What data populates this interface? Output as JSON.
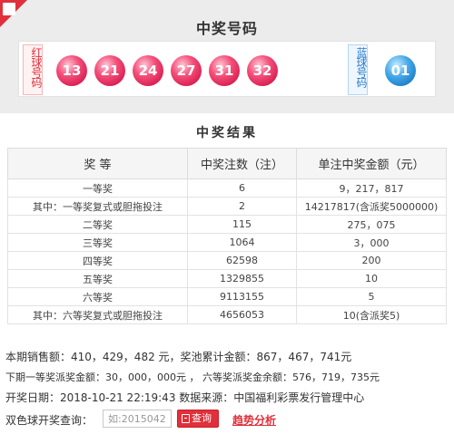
{
  "draw": {
    "title": "中奖号码",
    "red_label": "红球号码",
    "blue_label": "蓝球号码",
    "red_balls": [
      "13",
      "21",
      "24",
      "27",
      "31",
      "32"
    ],
    "blue_ball": "01",
    "colors": {
      "red": "#d81e50",
      "blue": "#1d7dc7",
      "accent": "#e0303b"
    }
  },
  "results": {
    "title": "中奖结果",
    "headers": [
      "奖 等",
      "中奖注数（注）",
      "单注中奖金额（元）"
    ],
    "rows": [
      [
        "一等奖",
        "6",
        "9，217，817"
      ],
      [
        "其中：一等奖复式或胆拖投注",
        "2",
        "14217817(含派奖5000000)"
      ],
      [
        "二等奖",
        "115",
        "275，075"
      ],
      [
        "三等奖",
        "1064",
        "3，000"
      ],
      [
        "四等奖",
        "62598",
        "200"
      ],
      [
        "五等奖",
        "1329855",
        "10"
      ],
      [
        "六等奖",
        "9113155",
        "5"
      ],
      [
        "其中：六等奖复式或胆拖投注",
        "4656053",
        "10(含派奖5)"
      ]
    ]
  },
  "summary": {
    "sales": "本期销售额：410，429，482 元，奖池累计金额：867，467，741元",
    "dispatch": "下期一等奖派奖金额：30，000，000元 ， 六等奖派奖金余额：576，719，735元",
    "date_source": "开奖日期：2018-10-21 22:19:43 数据来源：中国福利彩票发行管理中心"
  },
  "search": {
    "label": "双色球开奖查询：",
    "placeholder": "如:2015042",
    "button_label": "查询",
    "trend_link": "趋势分析"
  }
}
